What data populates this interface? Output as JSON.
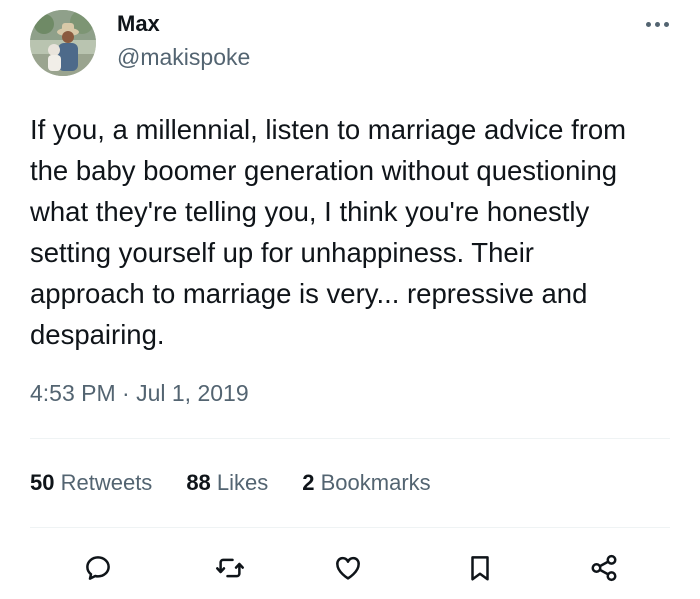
{
  "author": {
    "name": "Max",
    "handle": "@makispoke"
  },
  "tweet": {
    "text": "If you, a millennial, listen to marriage advice from\nthe baby boomer generation without questioning\nwhat they're telling you, I think you're honestly\nsetting yourself up for unhappiness. Their\napproach to marriage is very... repressive and\ndespairing.",
    "timestamp": "4:53 PM · Jul 1, 2019"
  },
  "stats": {
    "retweets": {
      "count": "50",
      "label": "Retweets"
    },
    "likes": {
      "count": "88",
      "label": "Likes"
    },
    "bookmarks": {
      "count": "2",
      "label": "Bookmarks"
    }
  },
  "icons": {
    "more": "more-horizontal-icon",
    "reply": "reply-icon",
    "retweet": "retweet-icon",
    "like": "heart-icon",
    "bookmark": "bookmark-icon",
    "share": "share-icon"
  },
  "colors": {
    "text_primary": "#0f1419",
    "text_secondary": "#536471",
    "divider": "#eff3f4"
  }
}
